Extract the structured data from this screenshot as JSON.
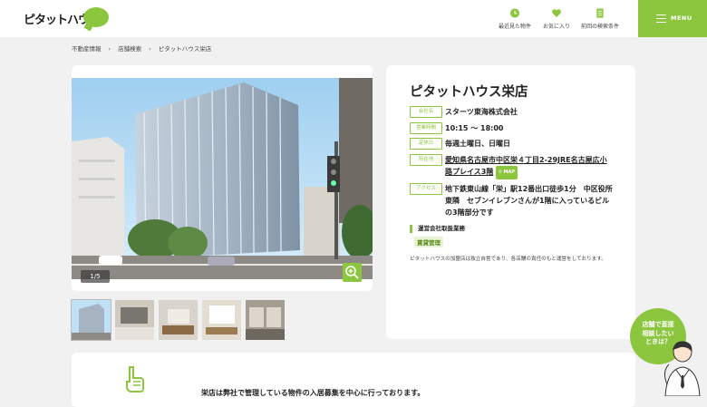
{
  "brand": {
    "logo_text": "ピタットハウス",
    "accent": "#8cc63f"
  },
  "header": {
    "nav": [
      {
        "label": "最近見た物件",
        "icon": "clock-icon"
      },
      {
        "label": "お気に入り",
        "icon": "heart-icon"
      },
      {
        "label": "前回の検索条件",
        "icon": "document-icon"
      }
    ],
    "menu_label": "MENU"
  },
  "breadcrumb": [
    "不動産情報",
    "店舗検索",
    "ピタットハウス栄店"
  ],
  "gallery": {
    "counter": "1/5",
    "thumb_count": 5
  },
  "shop": {
    "name": "ピタットハウス栄店",
    "rows": [
      {
        "tag": "会社名",
        "value": "スターツ東海株式会社"
      },
      {
        "tag": "営業時間",
        "value": "10:15 〜 18:00"
      },
      {
        "tag": "定休日",
        "value": "毎週土曜日、日曜日"
      },
      {
        "tag": "所在地",
        "value": "愛知県名古屋市中区栄４丁目2-29JRE名古屋広小路プレイス3階",
        "badge": "MAP"
      },
      {
        "tag": "アクセス",
        "value": "地下鉄東山線「栄」駅12番出口徒歩1分　中区役所東隣　セブンイレブンさんが1階に入っているビルの3階部分です"
      }
    ],
    "business_heading": "運営会社取扱業務",
    "business_item": "賃貸管理",
    "note": "ピタットハウスの加盟店は独立自営であり、各店舗の責任のもと運営をしております。"
  },
  "bottom": {
    "text": "栄店は弊社で管理している物件の入居募集を中心に行っております。"
  },
  "consult": {
    "lines": [
      "店舗で直接",
      "相談したい",
      "ときは？"
    ]
  }
}
